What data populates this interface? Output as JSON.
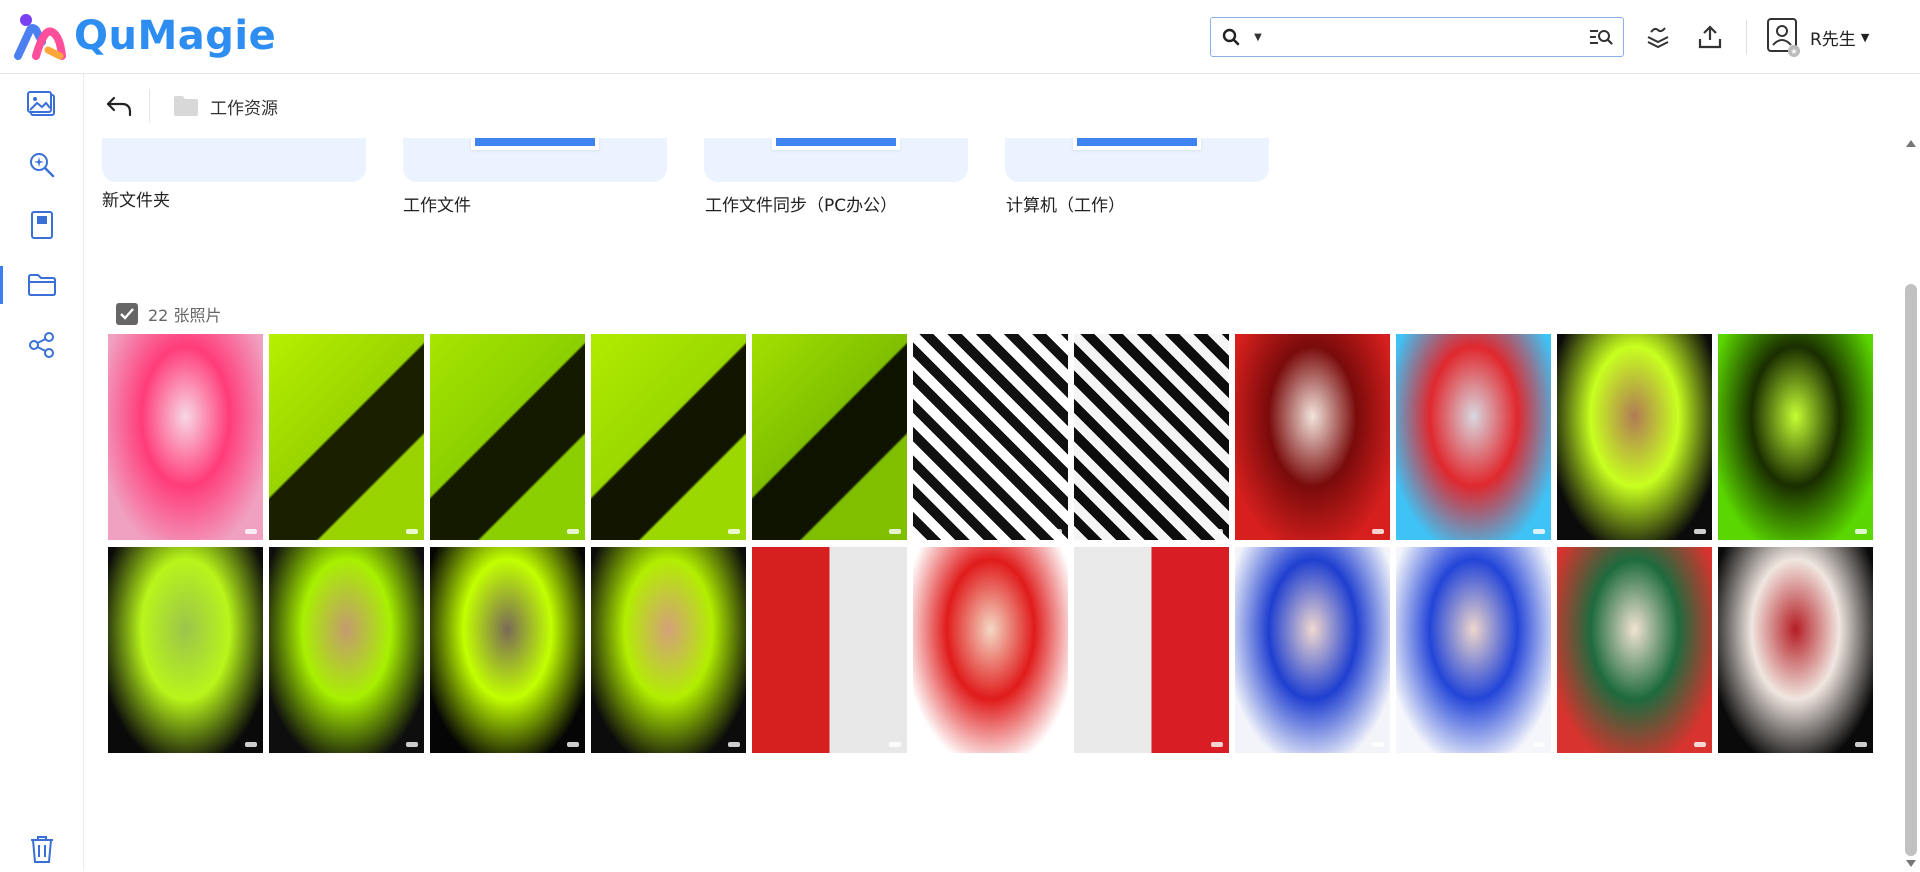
{
  "app": {
    "logo_text": "QuMagie",
    "brand_color": "#2e8df0",
    "accent_color": "#3a7ef0"
  },
  "search": {
    "value": "",
    "placeholder": "",
    "icon": "search-icon",
    "advanced_icon": "advanced-search-icon"
  },
  "toolbar": {
    "tasks_icon": "background-tasks-icon",
    "upload_icon": "upload-icon"
  },
  "user": {
    "name": "R先生",
    "avatar_icon": "user-avatar-icon"
  },
  "sidebar": {
    "items": [
      {
        "icon": "photos-icon",
        "active": false
      },
      {
        "icon": "smart-album-icon",
        "active": false
      },
      {
        "icon": "album-icon",
        "active": false
      },
      {
        "icon": "folder-icon",
        "active": true
      },
      {
        "icon": "share-icon",
        "active": false
      }
    ],
    "trash_icon": "trash-icon"
  },
  "breadcrumb": {
    "current": "工作资源"
  },
  "folders": [
    {
      "name": "新文件夹"
    },
    {
      "name": "工作文件"
    },
    {
      "name": "工作文件同步（PC办公）"
    },
    {
      "name": "计算机（工作）"
    }
  ],
  "photos": {
    "count_label": "22 张照片",
    "select_all_checked": true,
    "items": [
      {
        "theme": "pink-pop-art",
        "colors": [
          "#f0a0c0",
          "#ff3c7a",
          "#f7d7e4"
        ]
      },
      {
        "theme": "lime-silhouette",
        "colors": [
          "#b6f000",
          "#1a1f00",
          "#99d400"
        ]
      },
      {
        "theme": "lime-stairs",
        "colors": [
          "#a7e600",
          "#141a00",
          "#8bcf00"
        ]
      },
      {
        "theme": "lime-stairs-2",
        "colors": [
          "#b0ec00",
          "#121600",
          "#9ad800"
        ]
      },
      {
        "theme": "lime-stairs-3",
        "colors": [
          "#a2e000",
          "#0f1400",
          "#7fbf00"
        ]
      },
      {
        "theme": "bw-stripes",
        "colors": [
          "#ffffff",
          "#111111",
          "#cccccc"
        ]
      },
      {
        "theme": "bw-stripes-2",
        "colors": [
          "#f5f5f5",
          "#0d0d0d",
          "#999999"
        ]
      },
      {
        "theme": "red-corridor",
        "colors": [
          "#d7201e",
          "#7a0b0b",
          "#f2e4dc"
        ]
      },
      {
        "theme": "cyber-red-blue",
        "colors": [
          "#3fc2f5",
          "#e0282e",
          "#d8d8e0"
        ]
      },
      {
        "theme": "neon-face",
        "colors": [
          "#0b0b0b",
          "#c8ff1f",
          "#b07a55"
        ]
      },
      {
        "theme": "neon-face-2",
        "colors": [
          "#5ad700",
          "#1a2d00",
          "#c4ff34"
        ]
      },
      {
        "theme": "neon-face-3",
        "colors": [
          "#0a0a0a",
          "#b8f51a",
          "#9bc44b"
        ]
      },
      {
        "theme": "neon-face-4",
        "colors": [
          "#0e0e0e",
          "#a8f000",
          "#c49a70"
        ]
      },
      {
        "theme": "neon-face-5",
        "colors": [
          "#050505",
          "#c2ff00",
          "#7a6a58"
        ]
      },
      {
        "theme": "neon-face-6",
        "colors": [
          "#0c0c0c",
          "#b2ee00",
          "#d4a07a"
        ]
      },
      {
        "theme": "bw-portrait",
        "colors": [
          "#e8e8e8",
          "#1a1a1a",
          "#d62020"
        ]
      },
      {
        "theme": "red-hat",
        "colors": [
          "#ffffff",
          "#e01b1b",
          "#f4d8c4"
        ]
      },
      {
        "theme": "red-leaf",
        "colors": [
          "#d81e24",
          "#202020",
          "#eaeaea"
        ]
      },
      {
        "theme": "blue-tulle",
        "colors": [
          "#f2f4fa",
          "#1f3fd0",
          "#f0d8d0"
        ]
      },
      {
        "theme": "blue-tulle-2",
        "colors": [
          "#f4f6fb",
          "#2345d8",
          "#eed6cc"
        ]
      },
      {
        "theme": "green-red-hat",
        "colors": [
          "#d8332e",
          "#1e6b3e",
          "#f1e3d2"
        ]
      },
      {
        "theme": "cosmetic-compact",
        "colors": [
          "#0a0a0a",
          "#f0e6e0",
          "#b41d24"
        ]
      }
    ]
  }
}
